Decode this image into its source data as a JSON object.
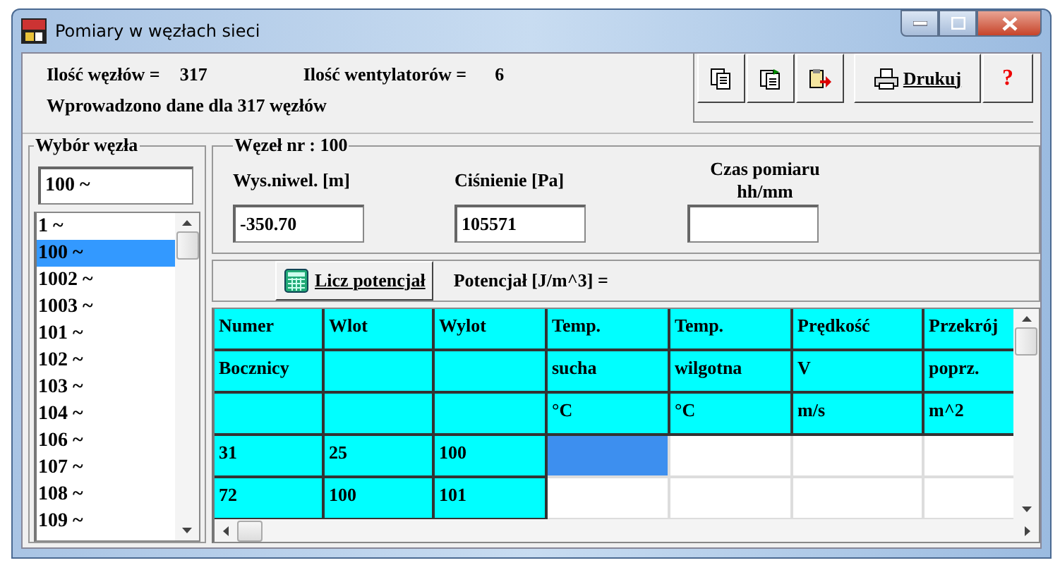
{
  "window": {
    "title": "Pomiary w węzłach sieci"
  },
  "summary": {
    "nodes_label": "Ilość węzłów =",
    "nodes_value": "317",
    "fans_label": "Ilość wentylatorów =",
    "fans_value": "6",
    "entered": "Wprowadzono dane dla  317 węzłów"
  },
  "toolbar": {
    "print_label": "Drukuj",
    "help_label": "?"
  },
  "node_picker": {
    "title": "Wybór węzła",
    "value": "100 ~",
    "items": [
      {
        "label": "1 ~",
        "selected": false
      },
      {
        "label": "100 ~",
        "selected": true
      },
      {
        "label": "1002 ~",
        "selected": false
      },
      {
        "label": "1003 ~",
        "selected": false
      },
      {
        "label": "101 ~",
        "selected": false
      },
      {
        "label": "102 ~",
        "selected": false
      },
      {
        "label": "103 ~",
        "selected": false
      },
      {
        "label": "104 ~",
        "selected": false
      },
      {
        "label": "106 ~",
        "selected": false
      },
      {
        "label": "107 ~",
        "selected": false
      },
      {
        "label": "108 ~",
        "selected": false
      },
      {
        "label": "109 ~",
        "selected": false
      }
    ]
  },
  "node": {
    "title": "Węzeł nr : 100",
    "fields": [
      {
        "label": "Wys.niwel. [m]",
        "value": "-350.70"
      },
      {
        "label": "Ciśnienie [Pa]",
        "value": "105571"
      },
      {
        "label": "Czas pomiaru hh/mm"
      }
    ]
  },
  "potential": {
    "button": "Licz potencjał",
    "label": "Potencjał [J/m^3] ="
  },
  "table": {
    "header_rows": [
      [
        "Numer",
        "Wlot",
        "Wylot",
        "Temp.",
        "Temp.",
        "Prędkość",
        "Przekrój"
      ],
      [
        "Bocznicy",
        "",
        "",
        "sucha",
        "wilgotna",
        "V",
        "poprz."
      ],
      [
        "",
        "",
        "",
        "°C",
        "°C",
        "m/s",
        "m^2"
      ]
    ],
    "rows": [
      {
        "cells": [
          "31",
          "25",
          "100"
        ],
        "data_cells": [
          {
            "selected": true
          },
          {
            "selected": false
          },
          {
            "selected": false
          },
          {
            "selected": false
          }
        ]
      },
      {
        "cells": [
          "72",
          "100",
          "101"
        ],
        "data_cells": [
          {
            "selected": false
          },
          {
            "selected": false
          },
          {
            "selected": false
          },
          {
            "selected": false
          }
        ]
      }
    ]
  }
}
